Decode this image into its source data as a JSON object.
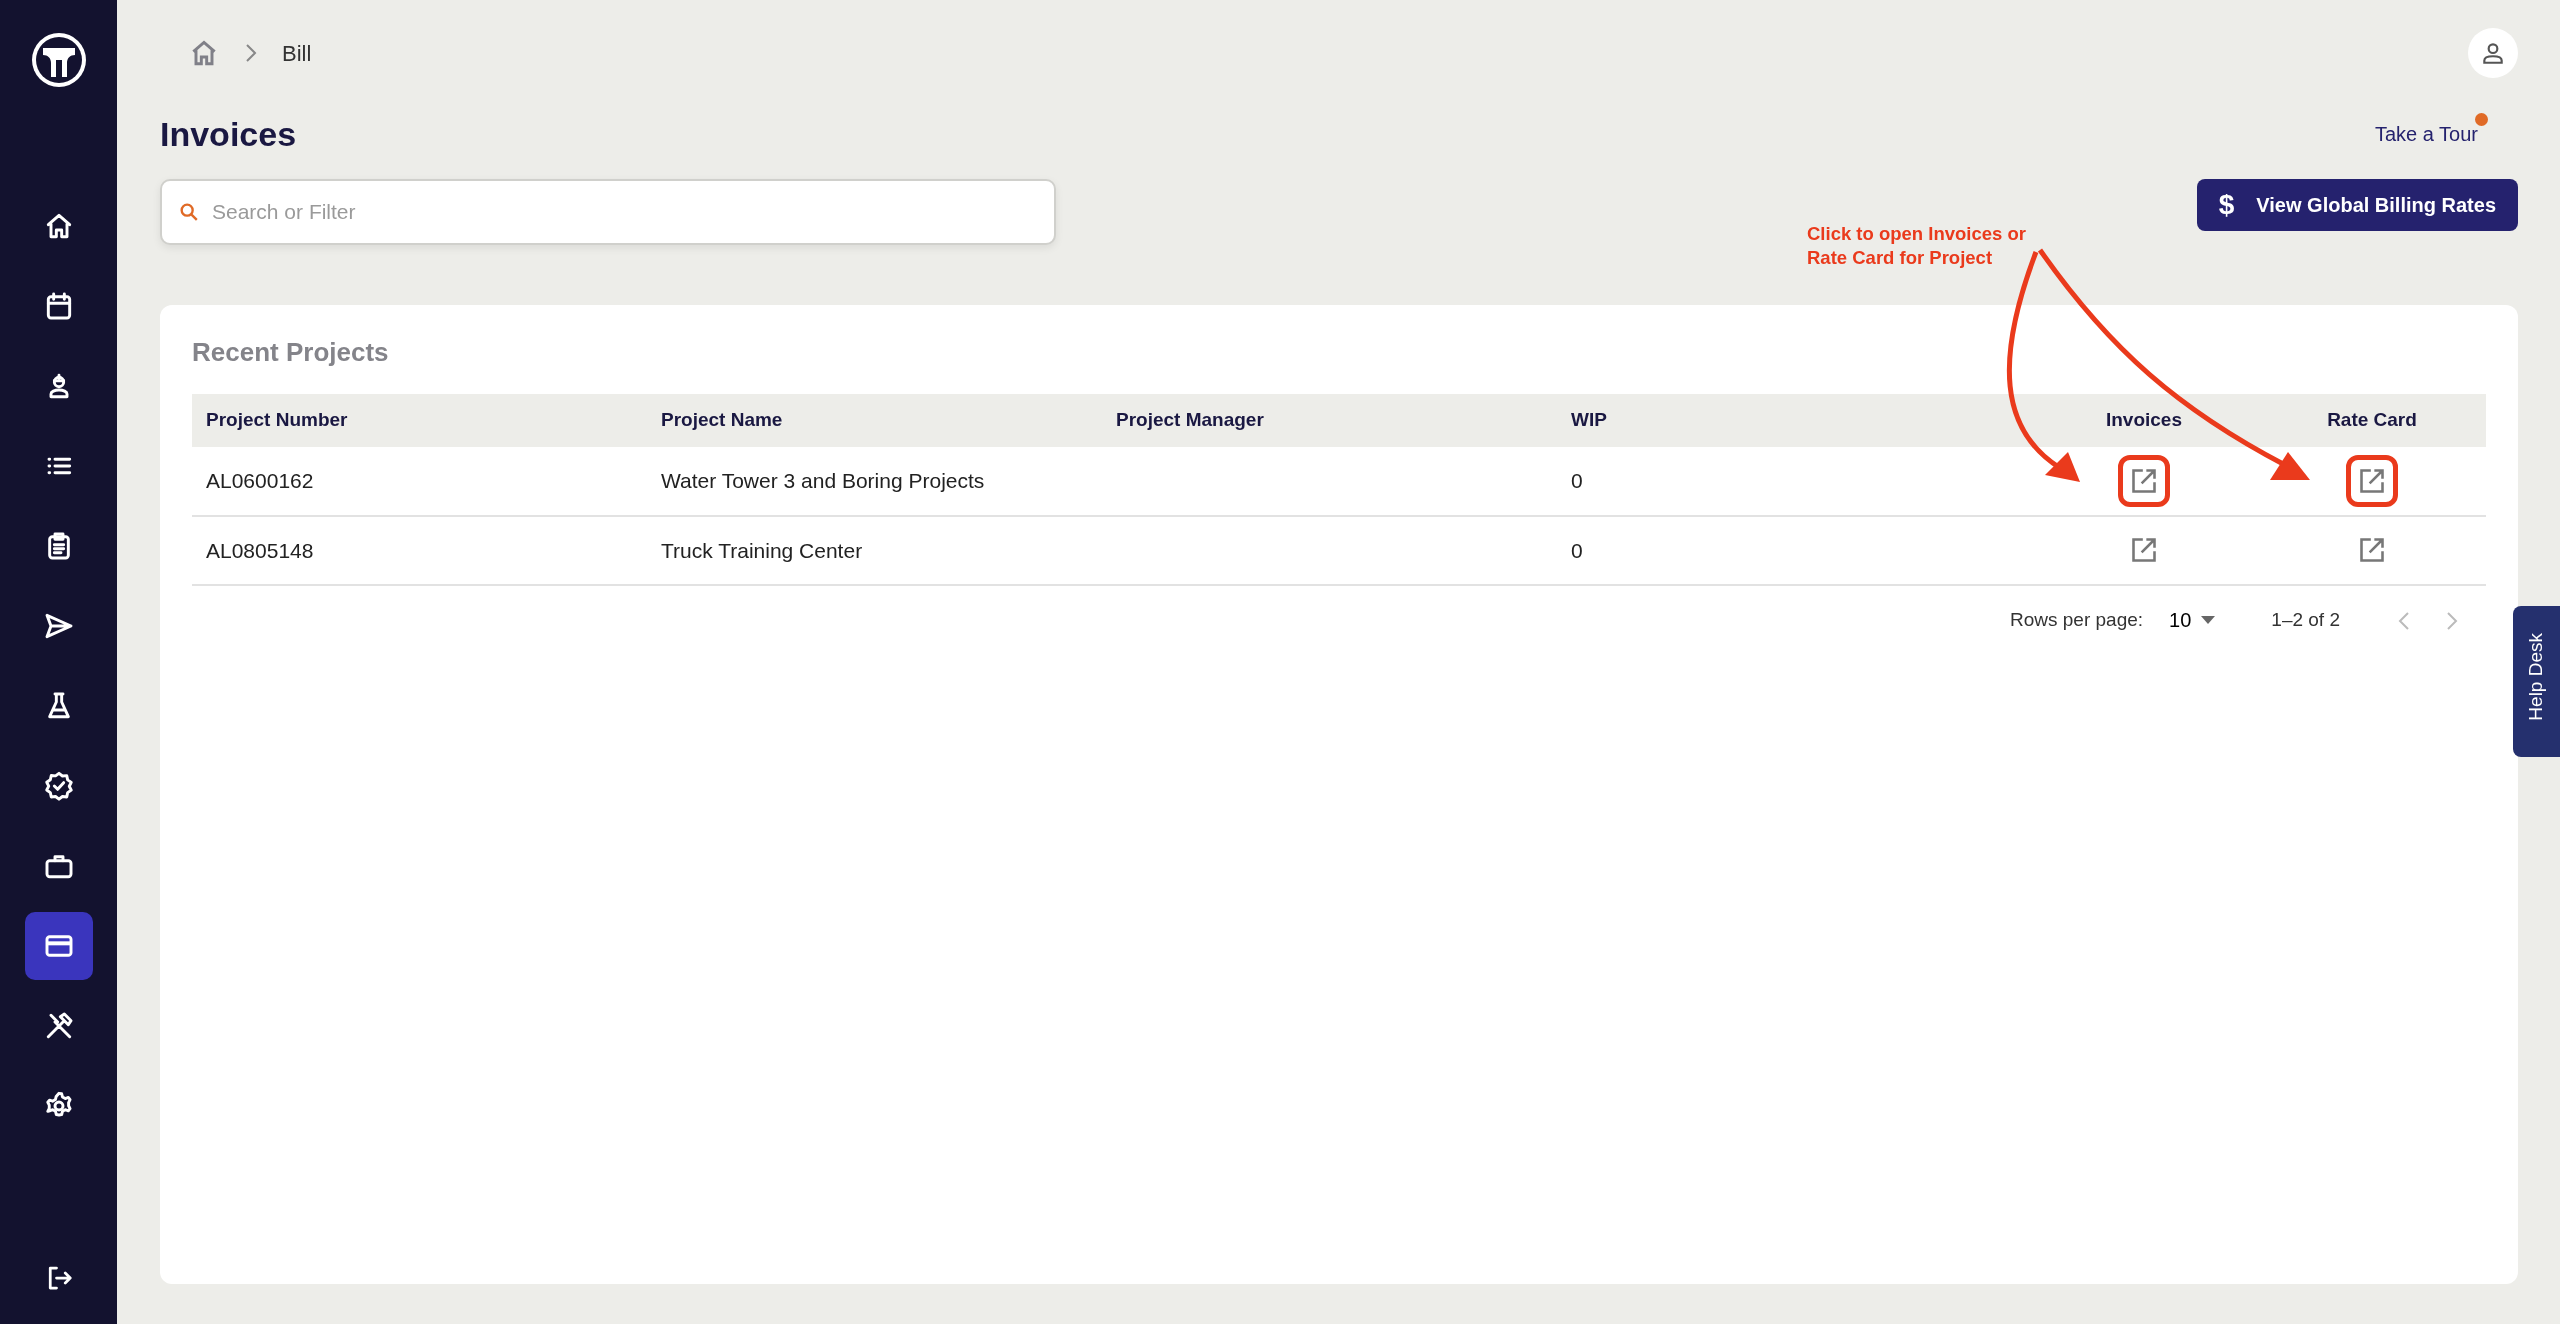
{
  "sidebar": {
    "items": [
      {
        "selected": false
      },
      {
        "selected": false
      },
      {
        "selected": false
      },
      {
        "selected": false
      },
      {
        "selected": false
      },
      {
        "selected": false
      },
      {
        "selected": false
      },
      {
        "selected": false
      },
      {
        "selected": false
      },
      {
        "selected": true
      },
      {
        "selected": false
      },
      {
        "selected": false
      }
    ]
  },
  "breadcrumb": [
    "Bill"
  ],
  "title": "Invoices",
  "take_tour": {
    "label": "Take a Tour",
    "notification": true
  },
  "search": {
    "placeholder": "Search or Filter"
  },
  "billing_button": {
    "label": "View Global Billing Rates",
    "icon": "$"
  },
  "annotation": {
    "text": "Click to open Invoices or Rate Card for Project"
  },
  "card": {
    "title": "Recent Projects",
    "table": {
      "columns": [
        "Project Number",
        "Project Name",
        "Project Manager",
        "WIP",
        "Invoices",
        "Rate Card"
      ],
      "rows": [
        {
          "project_number": "AL0600162",
          "project_name": "Water Tower 3 and Boring Projects",
          "project_manager": "",
          "wip": "0",
          "highlighted": true
        },
        {
          "project_number": "AL0805148",
          "project_name": "Truck Training Center",
          "project_manager": "",
          "wip": "0",
          "highlighted": false
        }
      ]
    },
    "pagination": {
      "rows_per_page_label": "Rows per page:",
      "rows_per_page": "10",
      "range": "1–2 of 2"
    }
  },
  "help_desk": "Help Desk"
}
